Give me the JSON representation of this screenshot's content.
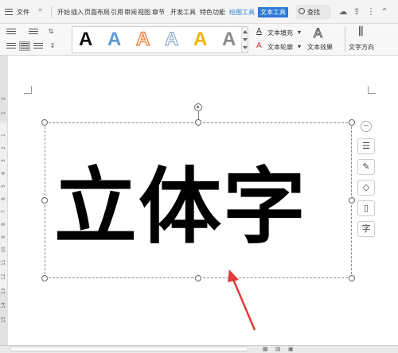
{
  "menubar": {
    "file_label": "文件",
    "tabs": [
      "开始",
      "插入",
      "页面布局",
      "引用",
      "审阅",
      "视图",
      "章节",
      "开发工具",
      "特色功能"
    ],
    "drawing_tools_label": "绘图工具",
    "text_tools_label": "文本工具",
    "search_label": "查找",
    "accent_color": "#2b7ad8"
  },
  "ribbon": {
    "text_styles": [
      {
        "glyph": "A",
        "color": "#111111",
        "style": "solid-black"
      },
      {
        "glyph": "A",
        "color": "#5a9bd5",
        "style": "blue-gradient"
      },
      {
        "glyph": "A",
        "color": "#ed8b4a",
        "style": "orange-outline"
      },
      {
        "glyph": "A",
        "color": "#ffffff",
        "style": "white-outline"
      },
      {
        "glyph": "A",
        "color": "#f2b400",
        "style": "yellow"
      },
      {
        "glyph": "A",
        "color": "#8a8a8a",
        "style": "gray-gradient"
      }
    ],
    "text_fill_label": "文本填充",
    "text_outline_label": "文本轮廓",
    "text_effect_label": "文本效果",
    "text_direction_label": "文字方向"
  },
  "document": {
    "wordart_text": "立体字"
  },
  "ruler": {
    "numbers": [
      "2",
      "1",
      "1",
      "2",
      "3",
      "4",
      "5",
      "6",
      "7",
      "8",
      "9",
      "10",
      "11",
      "12",
      "13",
      "14",
      "15"
    ]
  },
  "sidetools": {
    "collapse_icon": "minus-icon",
    "tools": [
      "layout-options-icon",
      "pen-icon",
      "shape-fill-icon",
      "frame-icon",
      "text-icon"
    ]
  }
}
